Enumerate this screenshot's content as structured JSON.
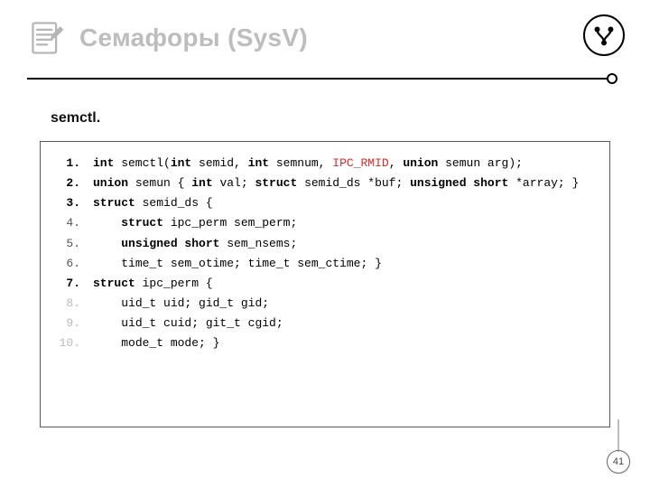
{
  "header": {
    "title": "Семафоры (SysV)",
    "doc_icon": "edit-doc-icon",
    "tree_icon": "git-branch-icon"
  },
  "subtitle": "semctl.",
  "code": {
    "lines": [
      {
        "n": "1.",
        "bold": true,
        "dim": false,
        "segments": [
          {
            "t": "int",
            "k": true
          },
          {
            "t": " semctl("
          },
          {
            "t": "int",
            "k": true
          },
          {
            "t": " semid, "
          },
          {
            "t": "int",
            "k": true
          },
          {
            "t": " semnum, "
          },
          {
            "t": "IPC_RMID",
            "r": true
          },
          {
            "t": ", "
          },
          {
            "t": "union",
            "k": true
          },
          {
            "t": " semun arg);"
          }
        ]
      },
      {
        "n": "2.",
        "bold": true,
        "dim": false,
        "segments": [
          {
            "t": "union",
            "k": true
          },
          {
            "t": " semun { "
          },
          {
            "t": "int",
            "k": true
          },
          {
            "t": " val; "
          },
          {
            "t": "struct",
            "k": true
          },
          {
            "t": " semid_ds *buf; "
          },
          {
            "t": "unsigned short",
            "k": true
          },
          {
            "t": " *array; }"
          }
        ]
      },
      {
        "n": "3.",
        "bold": true,
        "dim": false,
        "segments": [
          {
            "t": "struct",
            "k": true
          },
          {
            "t": " semid_ds {"
          }
        ]
      },
      {
        "n": "4.",
        "bold": false,
        "dim": false,
        "segments": [
          {
            "t": "    "
          },
          {
            "t": "struct",
            "k": true
          },
          {
            "t": " ipc_perm sem_perm;"
          }
        ]
      },
      {
        "n": "5.",
        "bold": false,
        "dim": false,
        "segments": [
          {
            "t": "    "
          },
          {
            "t": "unsigned short",
            "k": true
          },
          {
            "t": " sem_nsems;"
          }
        ]
      },
      {
        "n": "6.",
        "bold": false,
        "dim": false,
        "segments": [
          {
            "t": "    time_t sem_otime; time_t sem_ctime; }"
          }
        ]
      },
      {
        "n": "7.",
        "bold": true,
        "dim": false,
        "segments": [
          {
            "t": "struct",
            "k": true
          },
          {
            "t": " ipc_perm {"
          }
        ]
      },
      {
        "n": "8.",
        "bold": false,
        "dim": true,
        "segments": [
          {
            "t": "    uid_t uid; gid_t gid;"
          }
        ]
      },
      {
        "n": "9.",
        "bold": false,
        "dim": true,
        "segments": [
          {
            "t": "    uid_t cuid; git_t cgid;"
          }
        ]
      },
      {
        "n": "10.",
        "bold": false,
        "dim": true,
        "segments": [
          {
            "t": "    mode_t mode; }"
          }
        ]
      }
    ]
  },
  "page_number": "41"
}
